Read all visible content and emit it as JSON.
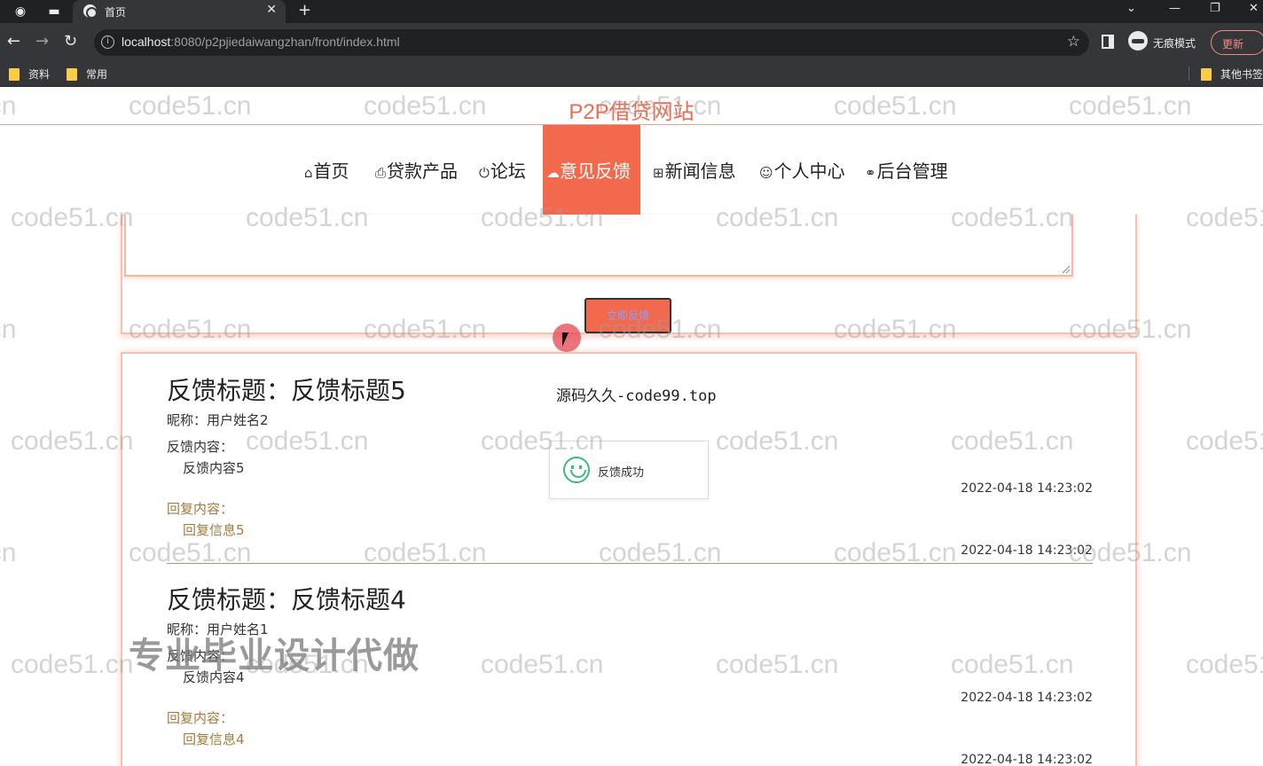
{
  "browser": {
    "tab_title": "首页",
    "url_host": "localhost",
    "url_rest": ":8080/p2pjiedaiwangzhan/front/index.html",
    "incognito_label": "无痕模式",
    "update_label": "更新",
    "bookmarks": [
      "资料",
      "常用"
    ],
    "other_bookmarks": "其他书签"
  },
  "site": {
    "title": "P2P借贷网站"
  },
  "nav": {
    "home": "首页",
    "loans": "贷款产品",
    "forum": "论坛",
    "feedback": "意见反馈",
    "news": "新闻信息",
    "personal": "个人中心",
    "admin": "后台管理",
    "active": "意见反馈",
    "active_color": "#f2694d"
  },
  "form": {
    "submit_label": "立即反馈"
  },
  "feedbacks": [
    {
      "title": "反馈标题：反馈标题5",
      "name": "昵称：用户姓名2",
      "content_label": "反馈内容：",
      "content": "反馈内容5",
      "time": "2022-04-18 14:23:02",
      "reply_label": "回复内容：",
      "reply": "回复信息5",
      "reply_time": "2022-04-18 14:23:02"
    },
    {
      "title": "反馈标题：反馈标题4",
      "name": "昵称：用户姓名1",
      "content_label": "反馈内容：",
      "content": "反馈内容4",
      "time": "2022-04-18 14:23:02",
      "reply_label": "回复内容：",
      "reply": "回复信息4",
      "reply_time": "2022-04-18 14:23:02"
    }
  ],
  "source_text": "源码久久-code99.top",
  "toast": {
    "message": "反馈成功"
  },
  "watermark_text": "code51.cn",
  "promo_text": "专业毕业设计代做",
  "colors": {
    "accent": "#f2694d",
    "reply_text": "#a37a3f",
    "success": "#3cba7a"
  }
}
